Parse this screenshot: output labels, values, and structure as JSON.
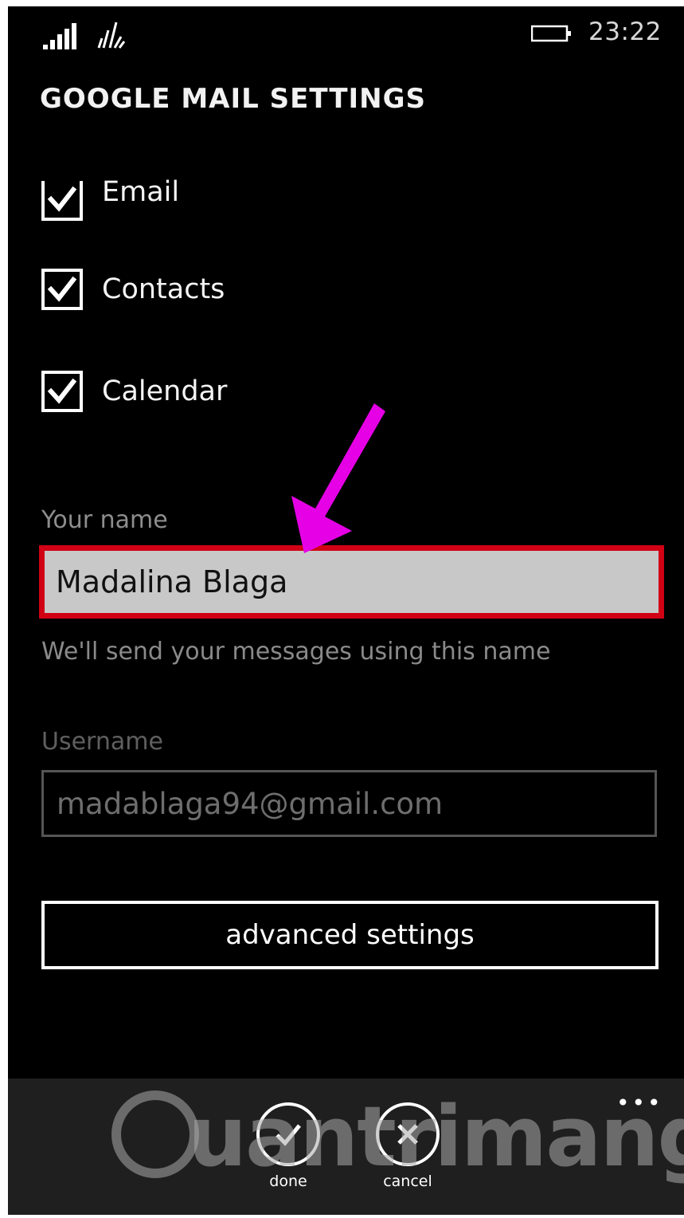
{
  "status_bar": {
    "time": "23:22",
    "signal_icon": "signal-bars-icon",
    "wifi_icon": "wifi-icon",
    "battery_icon": "battery-icon"
  },
  "page": {
    "title": "GOOGLE MAIL SETTINGS"
  },
  "sync_options": [
    {
      "label": "Email",
      "checked": true
    },
    {
      "label": "Contacts",
      "checked": true
    },
    {
      "label": "Calendar",
      "checked": true
    }
  ],
  "name_field": {
    "label": "Your name",
    "value": "Madalina Blaga",
    "hint": "We'll send your messages using this name"
  },
  "username_field": {
    "label": "Username",
    "value": "madablaga94@gmail.com"
  },
  "advanced_button": {
    "label": "advanced settings"
  },
  "app_bar": {
    "more_label": "•••",
    "done": {
      "label": "done",
      "icon": "checkmark-icon"
    },
    "cancel": {
      "label": "cancel",
      "icon": "close-icon"
    }
  },
  "watermark": {
    "text": "uantrimang"
  },
  "colors": {
    "background": "#000000",
    "highlight_border": "#d10015",
    "annotation_arrow": "#e600e6",
    "app_bar": "#1f1f1f"
  }
}
